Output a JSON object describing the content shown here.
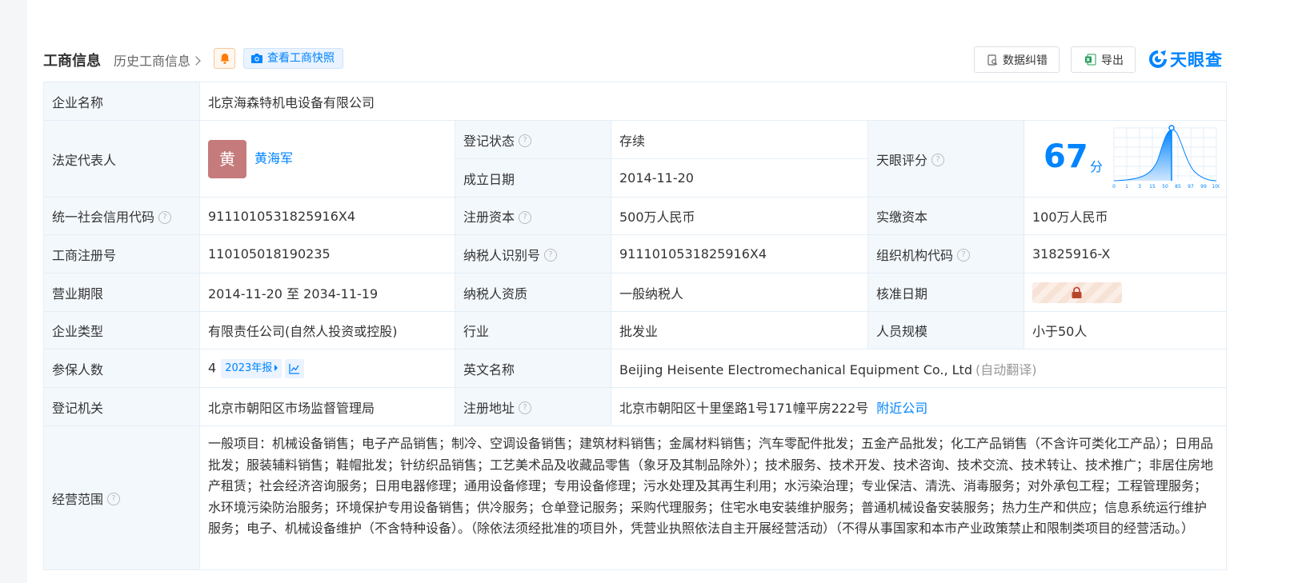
{
  "header": {
    "title": "工商信息",
    "history_link": "历史工商信息",
    "snapshot_btn": "查看工商快照",
    "error_btn": "数据纠错",
    "export_btn": "导出",
    "logo_text": "天眼查"
  },
  "rows": {
    "company_name": {
      "label": "企业名称",
      "value": "北京海森特机电设备有限公司"
    },
    "legal_rep": {
      "label": "法定代表人",
      "avatar_char": "黄",
      "name": "黄海军"
    },
    "reg_status": {
      "label": "登记状态",
      "value": "存续"
    },
    "found_date": {
      "label": "成立日期",
      "value": "2014-11-20"
    },
    "tianyan_score": {
      "label": "天眼评分",
      "value": "67",
      "unit": "分",
      "axis_ticks": [
        "0",
        "1",
        "3",
        "15",
        "50",
        "85",
        "97",
        "99",
        "100"
      ]
    },
    "credit_code": {
      "label": "统一社会信用代码",
      "value": "9111010531825916X4"
    },
    "reg_capital": {
      "label": "注册资本",
      "value": "500万人民币"
    },
    "paid_capital": {
      "label": "实缴资本",
      "value": "100万人民币"
    },
    "reg_number": {
      "label": "工商注册号",
      "value": "110105018190235"
    },
    "taxpayer_id": {
      "label": "纳税人识别号",
      "value": "9111010531825916X4"
    },
    "org_code": {
      "label": "组织机构代码",
      "value": "31825916-X"
    },
    "biz_term": {
      "label": "营业期限",
      "value": "2014-11-20 至 2034-11-19"
    },
    "taxpayer_qual": {
      "label": "纳税人资质",
      "value": "一般纳税人"
    },
    "approve_date": {
      "label": "核准日期"
    },
    "company_type": {
      "label": "企业类型",
      "value": "有限责任公司(自然人投资或控股)"
    },
    "industry": {
      "label": "行业",
      "value": "批发业"
    },
    "staff_size": {
      "label": "人员规模",
      "value": "小于50人"
    },
    "insured": {
      "label": "参保人数",
      "value": "4",
      "report_tag": "2023年报"
    },
    "english_name": {
      "label": "英文名称",
      "value": "Beijing Heisente Electromechanical Equipment Co., Ltd",
      "note": "(自动翻译)"
    },
    "reg_authority": {
      "label": "登记机关",
      "value": "北京市朝阳区市场监督管理局"
    },
    "reg_address": {
      "label": "注册地址",
      "value": "北京市朝阳区十里堡路1号171幢平房222号",
      "nearby_link": "附近公司"
    },
    "biz_scope": {
      "label": "经营范围",
      "value": "一般项目：机械设备销售；电子产品销售；制冷、空调设备销售；建筑材料销售；金属材料销售；汽车零配件批发；五金产品批发；化工产品销售（不含许可类化工产品）；日用品批发；服装辅料销售；鞋帽批发；针纺织品销售；工艺美术品及收藏品零售（象牙及其制品除外）；技术服务、技术开发、技术咨询、技术交流、技术转让、技术推广；非居住房地产租赁；社会经济咨询服务；日用电器修理；通用设备修理；专用设备修理；污水处理及其再生利用；水污染治理；专业保洁、清洗、消毒服务；对外承包工程；工程管理服务；水环境污染防治服务；环境保护专用设备销售；供冷服务；仓单登记服务；采购代理服务；住宅水电安装维护服务；普通机械设备安装服务；热力生产和供应；信息系统运行维护服务；电子、机械设备维护（不含特种设备）。（除依法须经批准的项目外，凭营业执照依法自主开展经营活动）（不得从事国家和本市产业政策禁止和限制类项目的经营活动。）"
    }
  },
  "colors": {
    "brand": "#0084ff",
    "status_green": "#00a65a",
    "label_bg": "#f3f8fd"
  }
}
